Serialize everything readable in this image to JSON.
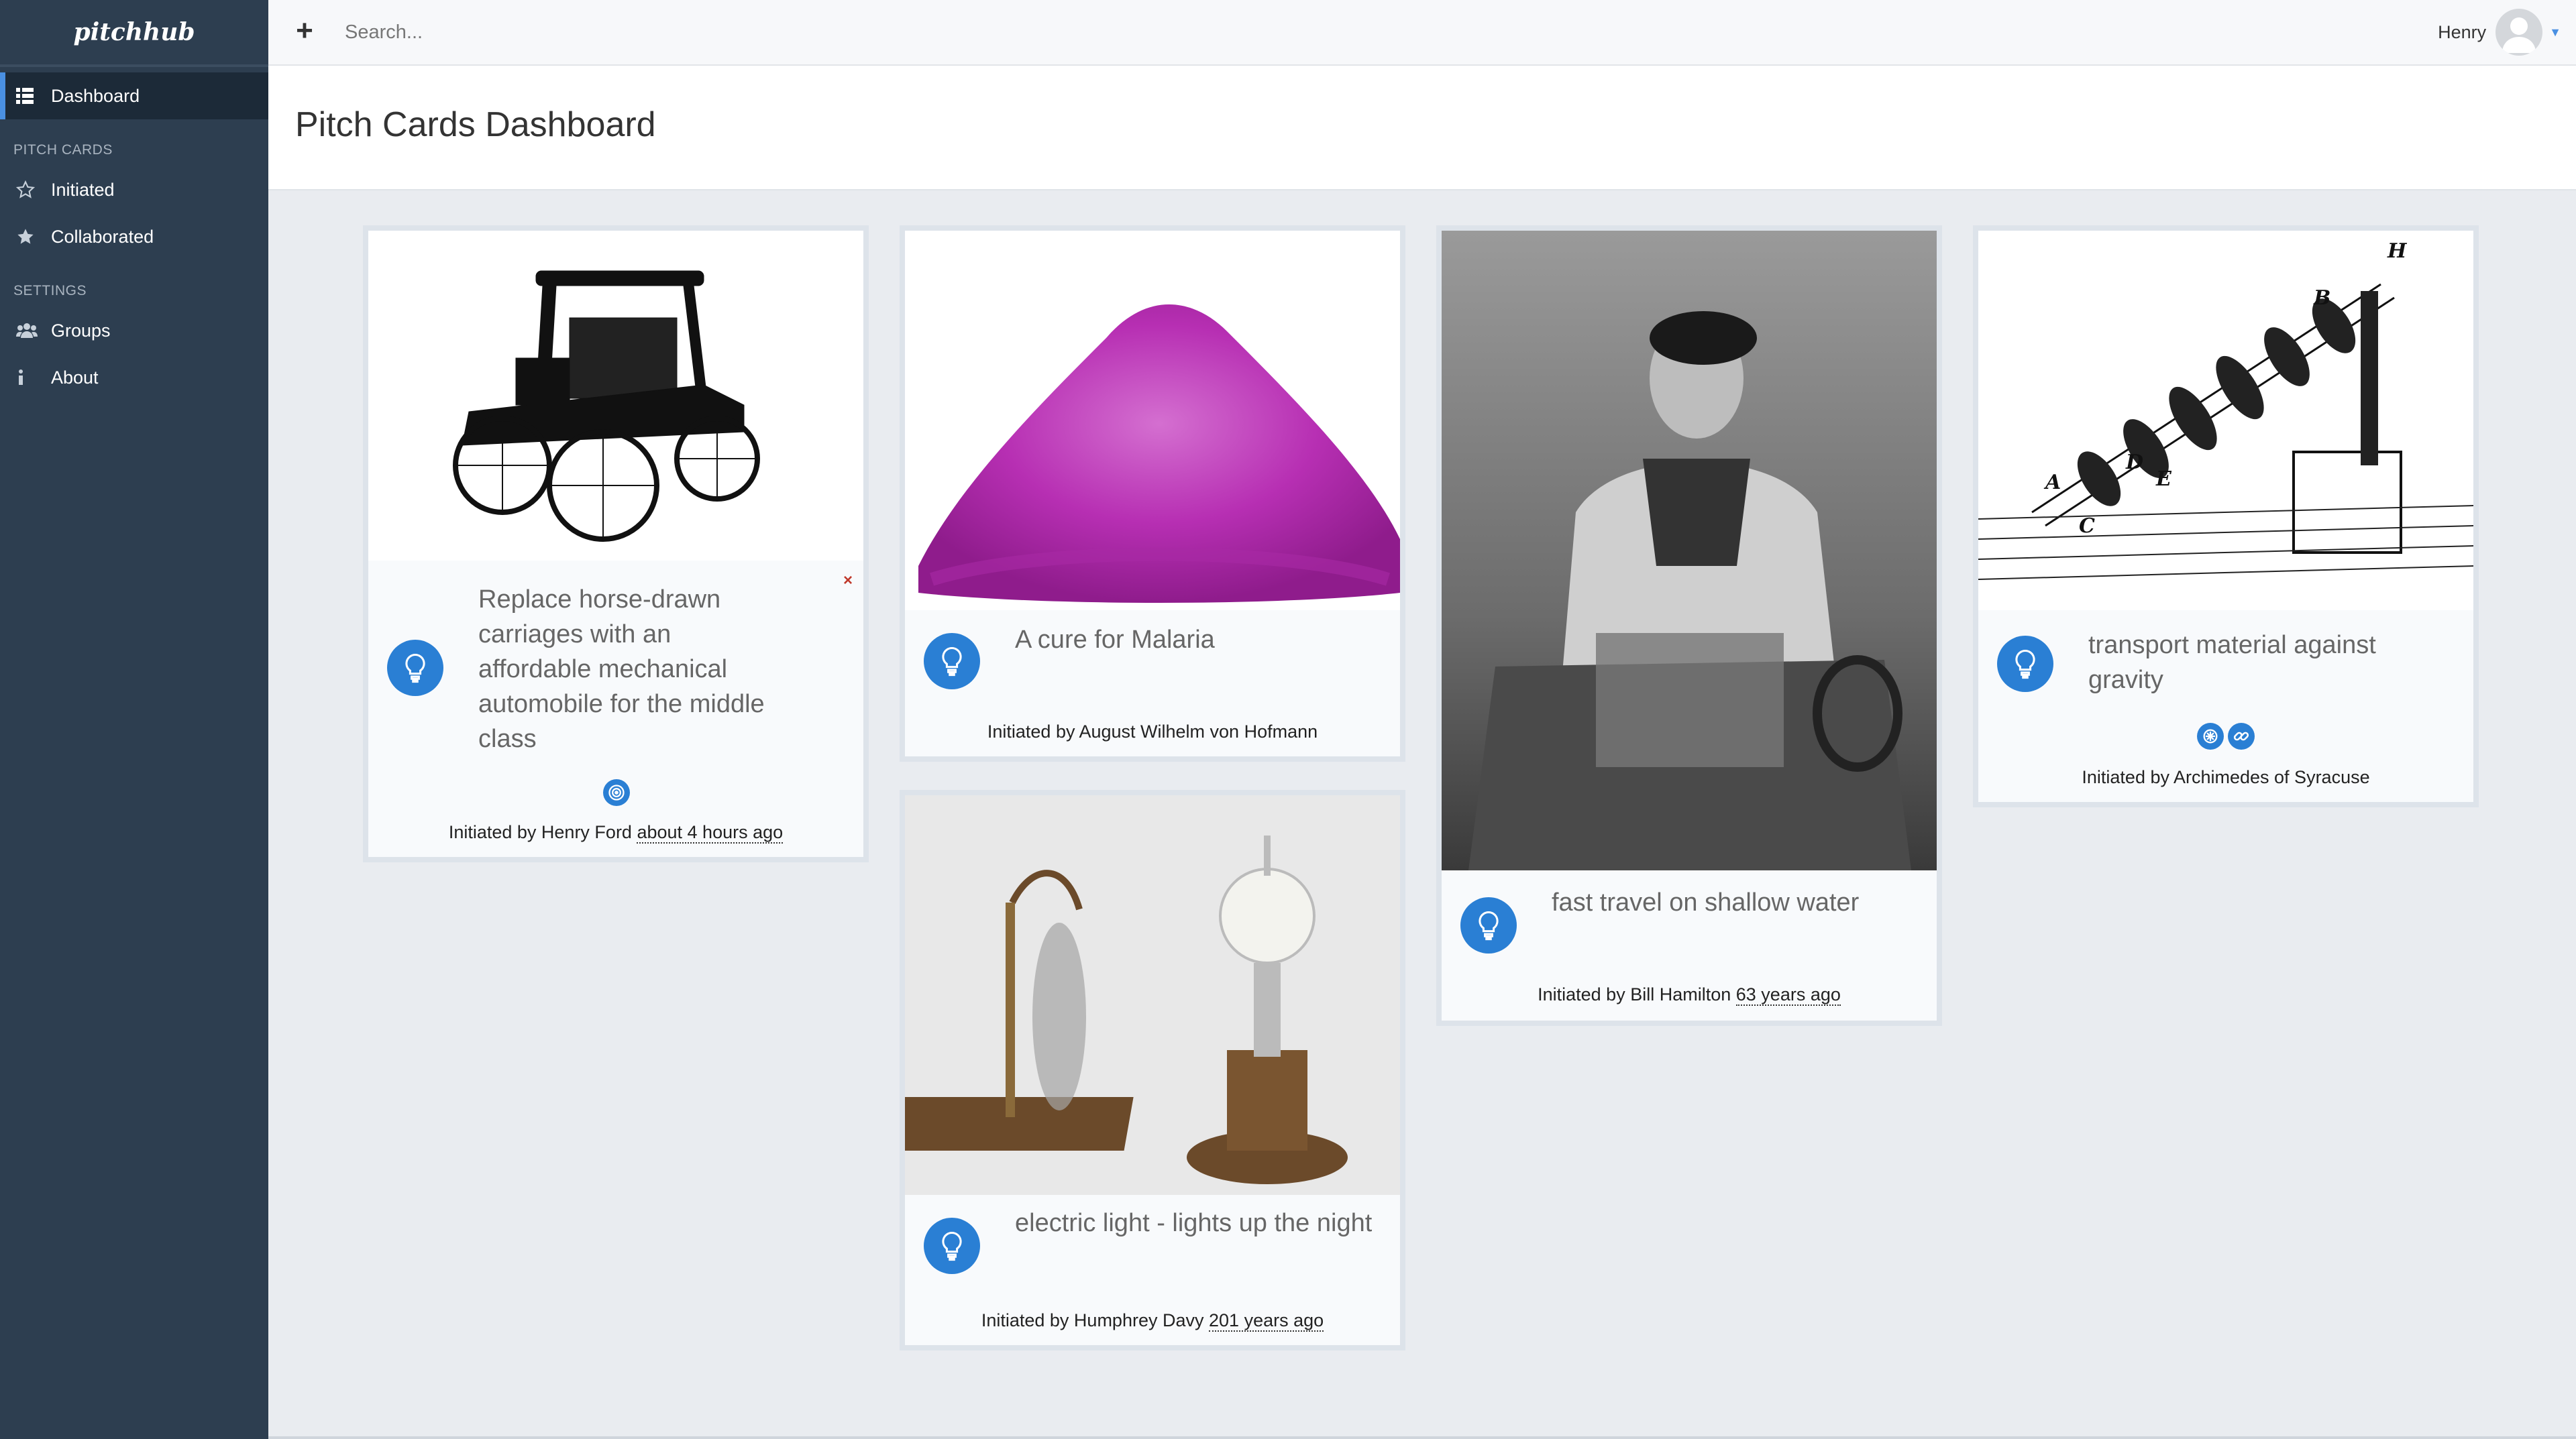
{
  "app": {
    "brand": "pitchhub"
  },
  "sidebar": {
    "dashboard_label": "Dashboard",
    "section_pitch_cards": "PITCH CARDS",
    "initiated_label": "Initiated",
    "collaborated_label": "Collaborated",
    "section_settings": "SETTINGS",
    "groups_label": "Groups",
    "about_label": "About"
  },
  "topbar": {
    "add_icon": "plus-icon",
    "search_placeholder": "Search...",
    "user_name": "Henry"
  },
  "page": {
    "title": "Pitch Cards Dashboard"
  },
  "cards": [
    {
      "title_lines": [
        "Replace horse-drawn",
        "carriages with an",
        "affordable mechanical",
        "automobile for the middle",
        "class"
      ],
      "initiated_prefix": "Initiated by Henry Ford",
      "time": "about 4 hours ago",
      "image": "vintage-automobile"
    },
    {
      "title": "A cure for Malaria",
      "initiated_prefix": "Initiated by August Wilhelm von Hofmann",
      "time": "",
      "image": "magenta-powder"
    },
    {
      "title": "electric light - lights up the night",
      "initiated_prefix": "Initiated by Humphrey Davy",
      "time": "201 years ago",
      "image": "light-bulb-apparatus"
    },
    {
      "title": "fast travel on shallow water",
      "initiated_prefix": "Initiated by Bill Hamilton",
      "time": "63 years ago",
      "image": "man-in-boat-photo"
    },
    {
      "title_lines": [
        "transport material against",
        "gravity"
      ],
      "initiated_prefix": "Initiated by Archimedes of Syracuse",
      "time": "",
      "image": "archimedes-screw-engraving"
    }
  ],
  "colors": {
    "sidebar": "#2d3e50",
    "accent": "#2a7fd4",
    "background": "#e9ecf0"
  }
}
